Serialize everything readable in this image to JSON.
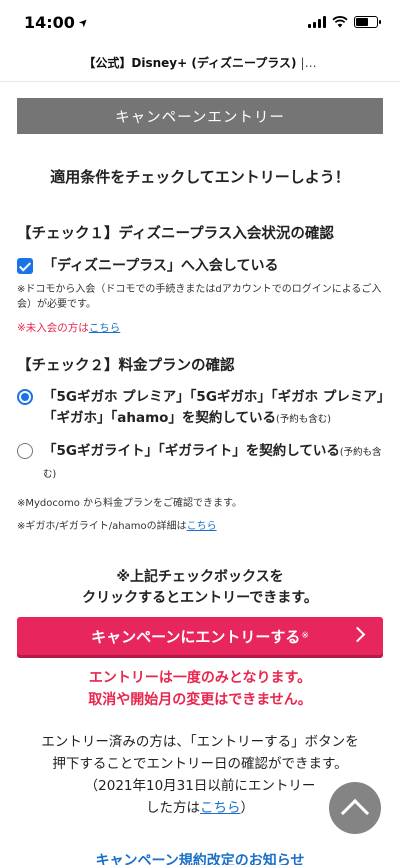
{
  "status_bar": {
    "time": "14:00",
    "location_glyph": "➤"
  },
  "browser": {
    "page_title": "【公式】Disney+ (ディズニープラス)",
    "more": "|…"
  },
  "header": {
    "title": "キャンペーンエントリー"
  },
  "lead": "適用条件をチェックしてエントリーしよう！",
  "check1": {
    "title": "【チェック１】ディズニープラス入会状況の確認",
    "option_label": "「ディズニープラス」へ入会している",
    "checked": true,
    "note": "※ドコモから入会（ドコモでの手続きまたはdアカウントでのログインによるご入会）が必要です。",
    "unjoined_prefix": "※未入会の方は",
    "unjoined_link": "こちら"
  },
  "check2": {
    "title": "【チェック２】料金プランの確認",
    "options": [
      {
        "label": "「5Gギガホ プレミア」「5Gギガホ」「ギガホ プレミア」「ギガホ」「ahamo」を契約している",
        "suffix": "(予約も含む)",
        "selected": true
      },
      {
        "label": "「5Gギガライト」「ギガライト」を契約している",
        "suffix": "(予約も含む)",
        "selected": false
      }
    ],
    "note_mydocomo": "※Mydocomo から料金プランをご確認できます。",
    "detail_prefix": "※ギガホ/ギガライト/ahamoの詳細は",
    "detail_link": "こちら"
  },
  "instruction": {
    "line1": "※上記チェックボックスを",
    "line2": "クリックするとエントリーできます。"
  },
  "entry_button": {
    "label": "キャンペーンにエントリーする",
    "mark": "※"
  },
  "warning": {
    "line1": "エントリーは一度のみとなります。",
    "line2": "取消や開始月の変更はできません。"
  },
  "entered": {
    "line1": "エントリー済みの方は、「エントリーする」ボタンを",
    "line2": "押下することでエントリー日の確認ができます。",
    "line3": "（2021年10月31日以前にエントリー",
    "line4_prefix": "した方は",
    "line4_link": "こちら",
    "line4_suffix": "）"
  },
  "bottom_link": "キャンペーン規約改定のお知らせ"
}
